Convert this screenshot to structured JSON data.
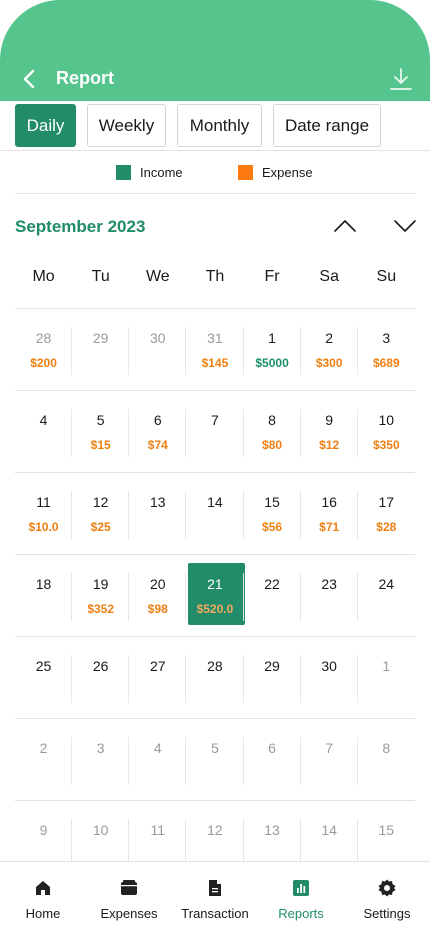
{
  "header": {
    "title": "Report"
  },
  "tabs": [
    {
      "label": "Daily",
      "active": true
    },
    {
      "label": "Weekly",
      "active": false
    },
    {
      "label": "Monthly",
      "active": false
    },
    {
      "label": "Date range",
      "active": false
    }
  ],
  "legend": {
    "income": {
      "label": "Income",
      "color": "#218b6a"
    },
    "expense": {
      "label": "Expense",
      "color": "#ff7a0e"
    }
  },
  "calendar": {
    "month_title": "September 2023",
    "weekdays": [
      "Mo",
      "Tu",
      "We",
      "Th",
      "Fr",
      "Sa",
      "Su"
    ],
    "weeks": [
      [
        {
          "day": "28",
          "muted": true,
          "amount": "$200",
          "kind": "expense"
        },
        {
          "day": "29",
          "muted": true
        },
        {
          "day": "30",
          "muted": true
        },
        {
          "day": "31",
          "muted": true,
          "amount": "$145",
          "kind": "expense"
        },
        {
          "day": "1",
          "amount": "$5000",
          "kind": "income"
        },
        {
          "day": "2",
          "amount": "$300",
          "kind": "expense"
        },
        {
          "day": "3",
          "amount": "$689",
          "kind": "expense"
        }
      ],
      [
        {
          "day": "4"
        },
        {
          "day": "5",
          "amount": "$15",
          "kind": "expense"
        },
        {
          "day": "6",
          "amount": "$74",
          "kind": "expense"
        },
        {
          "day": "7"
        },
        {
          "day": "8",
          "amount": "$80",
          "kind": "expense"
        },
        {
          "day": "9",
          "amount": "$12",
          "kind": "expense"
        },
        {
          "day": "10",
          "amount": "$350",
          "kind": "expense"
        }
      ],
      [
        {
          "day": "11",
          "amount": "$10.0",
          "kind": "expense"
        },
        {
          "day": "12",
          "amount": "$25",
          "kind": "expense"
        },
        {
          "day": "13"
        },
        {
          "day": "14"
        },
        {
          "day": "15",
          "amount": "$56",
          "kind": "expense"
        },
        {
          "day": "16",
          "amount": "$71",
          "kind": "expense"
        },
        {
          "day": "17",
          "amount": "$28",
          "kind": "expense"
        }
      ],
      [
        {
          "day": "18"
        },
        {
          "day": "19",
          "amount": "$352",
          "kind": "expense"
        },
        {
          "day": "20",
          "amount": "$98",
          "kind": "expense"
        },
        {
          "day": "21",
          "amount": "$520.0",
          "kind": "expense",
          "selected": true
        },
        {
          "day": "22"
        },
        {
          "day": "23"
        },
        {
          "day": "24"
        }
      ],
      [
        {
          "day": "25"
        },
        {
          "day": "26"
        },
        {
          "day": "27"
        },
        {
          "day": "28"
        },
        {
          "day": "29"
        },
        {
          "day": "30"
        },
        {
          "day": "1",
          "muted": true
        }
      ],
      [
        {
          "day": "2",
          "muted": true
        },
        {
          "day": "3",
          "muted": true
        },
        {
          "day": "4",
          "muted": true
        },
        {
          "day": "5",
          "muted": true
        },
        {
          "day": "6",
          "muted": true
        },
        {
          "day": "7",
          "muted": true
        },
        {
          "day": "8",
          "muted": true
        }
      ],
      [
        {
          "day": "9",
          "muted": true
        },
        {
          "day": "10",
          "muted": true
        },
        {
          "day": "11",
          "muted": true
        },
        {
          "day": "12",
          "muted": true
        },
        {
          "day": "13",
          "muted": true
        },
        {
          "day": "14",
          "muted": true
        },
        {
          "day": "15",
          "muted": true
        }
      ]
    ]
  },
  "bottom_nav": [
    {
      "label": "Home",
      "icon": "home-icon",
      "active": false
    },
    {
      "label": "Expenses",
      "icon": "wallet-icon",
      "active": false
    },
    {
      "label": "Transaction",
      "icon": "document-icon",
      "active": false
    },
    {
      "label": "Reports",
      "icon": "chart-icon",
      "active": true
    },
    {
      "label": "Settings",
      "icon": "gear-icon",
      "active": false
    }
  ],
  "colors": {
    "header_bg": "#55c58d",
    "accent": "#218b6a",
    "expense": "#f07f11",
    "income": "#1e8f6b"
  }
}
